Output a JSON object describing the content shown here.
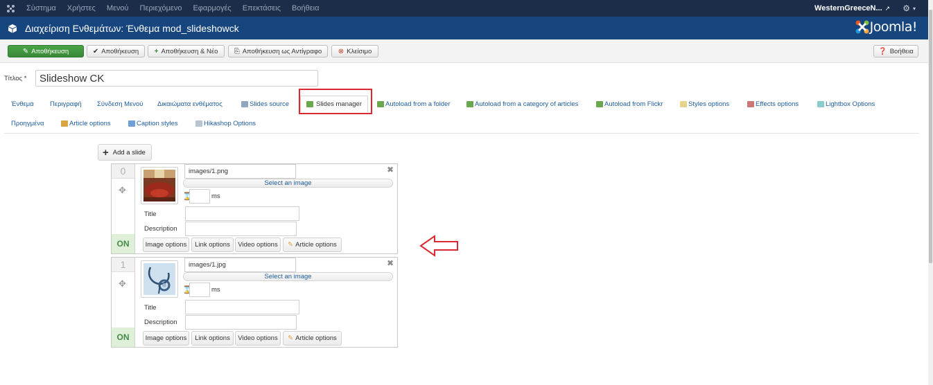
{
  "topmenu": {
    "items": [
      "Σύστημα",
      "Χρήστες",
      "Μενού",
      "Περιεχόμενο",
      "Εφαρμογές",
      "Επεκτάσεις",
      "Βοήθεια"
    ],
    "site_name": "WesternGreeceN...",
    "icons": [
      "joomla-icon",
      "external-link-icon",
      "gear-icon"
    ]
  },
  "header": {
    "title": "Διαχείριση Ενθεμάτων: Ένθεμα mod_slideshowck",
    "brand": "Joomla!",
    "brand_colors": [
      "#e4572e",
      "#f9a541",
      "#7ac143",
      "#1c9ad6"
    ]
  },
  "toolbar": {
    "save_primary": "Αποθήκευση",
    "save": "Αποθήκευση",
    "save_new": "Αποθήκευση & Νέο",
    "save_copy": "Αποθήκευση ως Αντίγραφο",
    "close": "Κλείσιμο",
    "help": "Βοήθεια"
  },
  "title_field": {
    "label": "Τίτλος *",
    "value": "Slideshow CK"
  },
  "tabs": {
    "row1": [
      "Ένθεμα",
      "Περιγραφή",
      "Σύνδεση Μενού",
      "Δικαιώματα ενθέματος",
      "Slides source",
      "Slides manager",
      "Autoload from a folder",
      "Autoload from a category of articles",
      "Autoload from Flickr",
      "Styles options",
      "Effects options",
      "Lightbox Options"
    ],
    "row2": [
      "Προηγμένα",
      "Article options",
      "Caption styles",
      "Hikashop Options"
    ],
    "active": "Slides manager"
  },
  "slides_manager": {
    "add_label": "Add a slide",
    "select_image_label": "Select an image",
    "ms_label": "ms",
    "title_label": "Title",
    "description_label": "Description",
    "state_label": "ON",
    "buttons": [
      "Image options",
      "Link options",
      "Video options",
      "Article options"
    ],
    "slides": [
      {
        "index": "0",
        "path": "images/1.png",
        "thumb": "parliament-hall"
      },
      {
        "index": "1",
        "path": "images/1.jpg",
        "thumb": "stethoscope"
      }
    ]
  },
  "annotation": {
    "arrow_color": "#d9282f",
    "highlight_color": "#d9282f"
  }
}
